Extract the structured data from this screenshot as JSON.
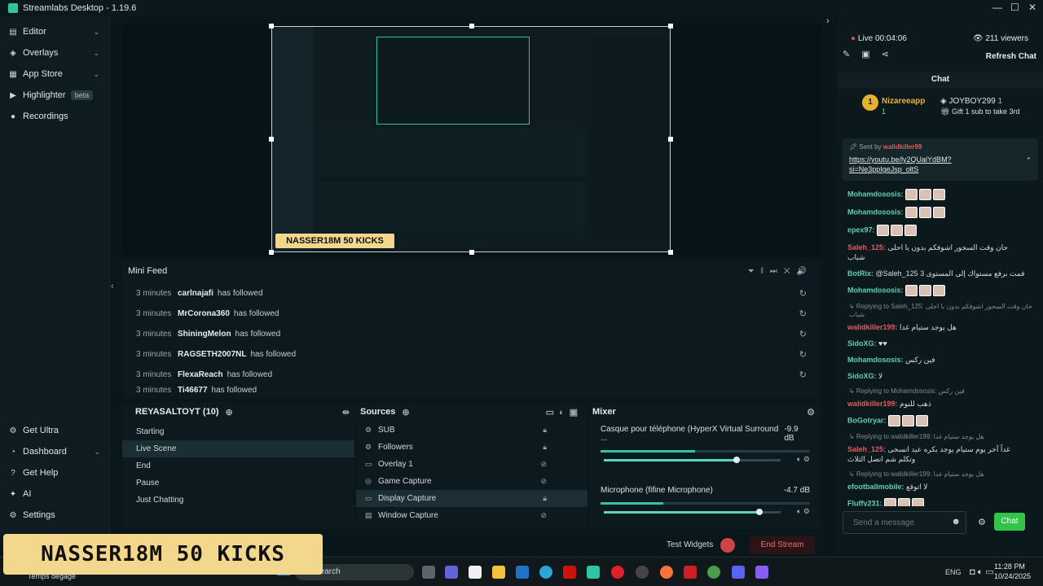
{
  "window": {
    "title": "Streamlabs Desktop - 1.19.6"
  },
  "nav": {
    "top": [
      {
        "label": "Editor",
        "icon": "editor-icon"
      },
      {
        "label": "Overlays",
        "icon": "overlays-icon"
      },
      {
        "label": "App Store",
        "icon": "app-store-icon"
      },
      {
        "label": "Highlighter",
        "icon": "highlighter-icon",
        "badge": "beta"
      },
      {
        "label": "Recordings",
        "icon": "recordings-icon"
      }
    ],
    "bottom": [
      {
        "label": "Get Ultra"
      },
      {
        "label": "Dashboard"
      },
      {
        "label": "Get Help"
      },
      {
        "label": "AI"
      },
      {
        "label": "Settings"
      }
    ]
  },
  "preview": {
    "overlay_banner": "NASSER18M 50 KICKS"
  },
  "minifeed": {
    "title": "Mini Feed",
    "rows": [
      {
        "time": "3 minutes",
        "name": "carlnajafi",
        "action": "has followed"
      },
      {
        "time": "3 minutes",
        "name": "MrCorona360",
        "action": "has followed"
      },
      {
        "time": "3 minutes",
        "name": "ShiningMelon",
        "action": "has followed"
      },
      {
        "time": "3 minutes",
        "name": "RAGSETH2007NL",
        "action": "has followed"
      },
      {
        "time": "3 minutes",
        "name": "FlexaReach",
        "action": "has followed"
      },
      {
        "time": "3 minutes",
        "name": "Ti46677",
        "action": "has followed"
      }
    ]
  },
  "scenes": {
    "title": "REYASALTOYT (10)",
    "items": [
      "Starting",
      "Live Scene",
      "End",
      "Pause",
      "Just Chatting"
    ],
    "active": 1
  },
  "sources": {
    "title": "Sources",
    "items": [
      "SUB",
      "Followers",
      "Overlay 1",
      "Game Capture",
      "Display Capture",
      "Window Capture"
    ],
    "active": 4
  },
  "mixer": {
    "title": "Mixer",
    "channels": [
      {
        "name": "Casque pour téléphone (HyperX Virtual Surround ...",
        "db": "-9.9 dB",
        "meter": 0.45,
        "volume": 0.75
      },
      {
        "name": "Microphone (fifine Microphone)",
        "db": "-4.7 dB",
        "meter": 0.3,
        "volume": 0.88
      }
    ]
  },
  "footer": {
    "test_widgets": "Test Widgets",
    "end_stream": "End Stream"
  },
  "chat": {
    "live": "Live 00:04:06",
    "viewers": "211 viewers",
    "refresh": "Refresh Chat",
    "title": "Chat",
    "top_gifter": "Nizareeapp",
    "top_gifter_count": "1",
    "second": "JOYBOY299",
    "second_count": "1",
    "gift_msg": "Gift 1 sub to take 3rd",
    "pinned_by": "Sent by",
    "pinned_user": "walidkiller99",
    "pinned_link": "https://youtu.be/ly2QUalYdBM?si=Ne3ppIgeJsp_oltS",
    "messages": [
      {
        "user": "Mohamdososis",
        "text": ""
      },
      {
        "user": "Mohamdososis",
        "text": ""
      },
      {
        "user": "epex97",
        "text": ""
      },
      {
        "user": "Saleh_125",
        "text": "حان وقت السحور اشوفكم بدون يا احلى شباب",
        "red": true
      },
      {
        "user": "BotRix",
        "text": "@Saleh_125 فمت برفع مستواك إلى المستوى 3"
      },
      {
        "user": "Mohamdososis",
        "text": ""
      },
      {
        "reply": "Replying to Saleh_125: حان وقت السحور اشوفكم بدون يا احلى شباب"
      },
      {
        "user": "walidkiller199",
        "text": "هل يوجد ستيام غدا",
        "red": true
      },
      {
        "user": "SidoXG",
        "text": "♥♥"
      },
      {
        "user": "Mohamdososis",
        "text": "فين ركس"
      },
      {
        "user": "SidoXG",
        "text": "لا"
      },
      {
        "reply": "Replying to Mohamdososis: فين ركس"
      },
      {
        "user": "walidkiller199",
        "text": "ذهب للنوم",
        "red": true
      },
      {
        "user": "BoGotryar",
        "text": ""
      },
      {
        "reply": "Replying to walidkiller199: هل يوجد ستيام غدا"
      },
      {
        "user": "Saleh_125",
        "text": "غداً آخر يوم ستيام يوجد بكره عيد انسحى وتكلم شم اتصل الثلاث",
        "red": true
      },
      {
        "reply": "Replying to walidkiller199: هل يوجد ستيام غدا"
      },
      {
        "user": "efootballmobile",
        "text": "لا اتوقع"
      },
      {
        "user": "Fluffy231",
        "text": ""
      }
    ],
    "input_placeholder": "Send a message",
    "send": "Chat"
  },
  "taskbar": {
    "search": "Search",
    "weather": "Temps dégagé",
    "lang": "ENG",
    "time": "11:28 PM",
    "date": "10/24/2025"
  }
}
